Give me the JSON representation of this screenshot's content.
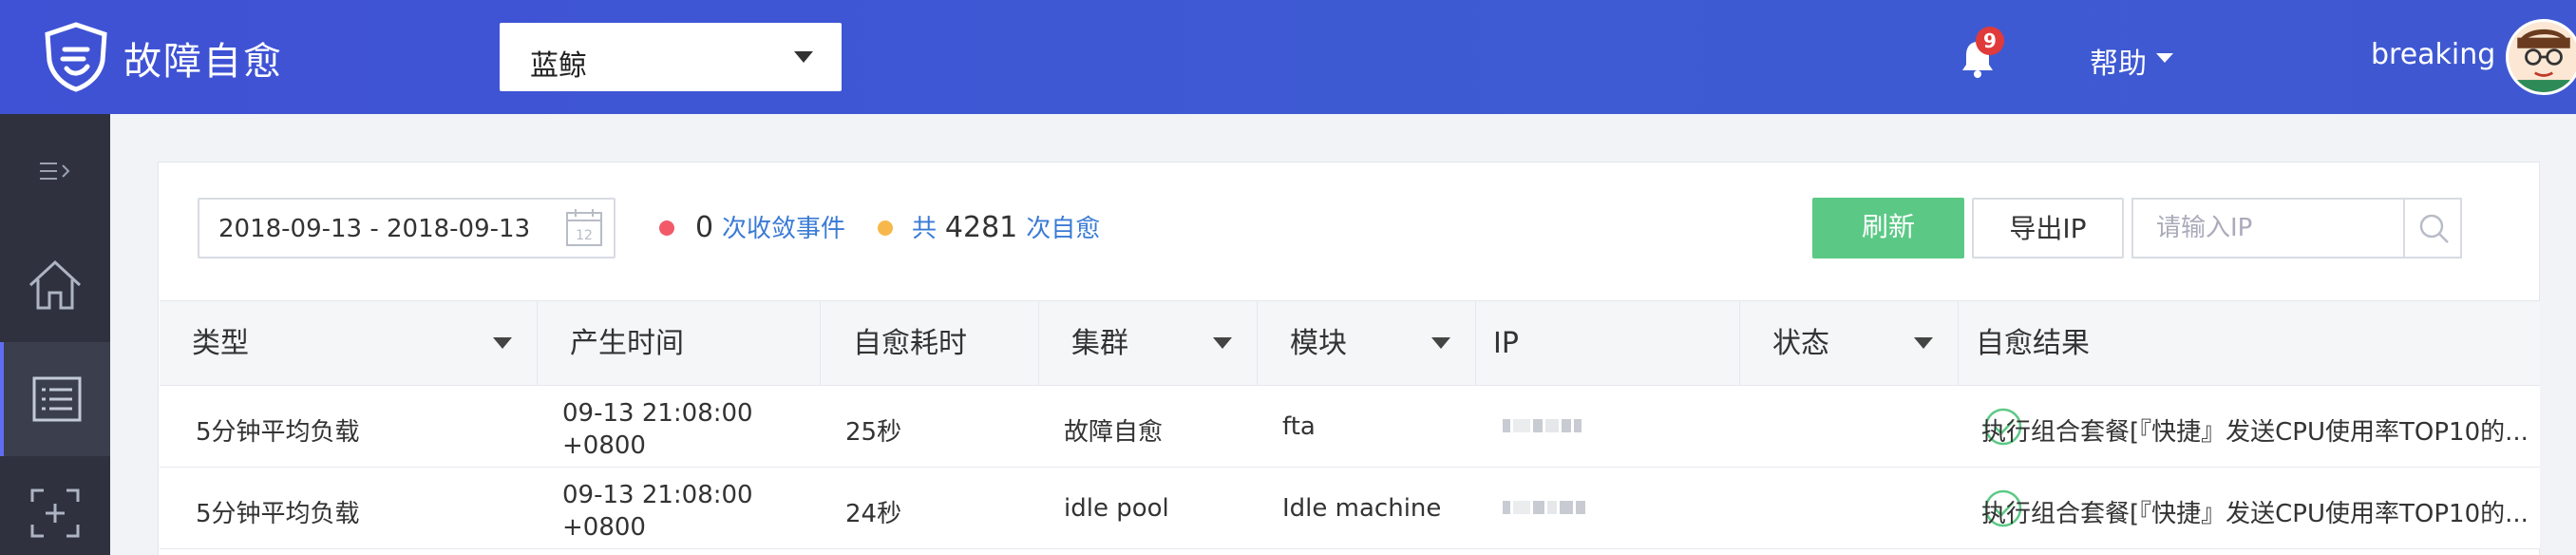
{
  "header": {
    "brand": "故障自愈",
    "cluster_select": "蓝鲸",
    "notification_count": "9",
    "help": "帮助",
    "username": "breaking"
  },
  "sidebar": {
    "items": [
      "menu-toggle",
      "home",
      "list",
      "add-scope"
    ]
  },
  "toolbar": {
    "date_range": "2018-09-13 - 2018-09-13",
    "converge_count": "0",
    "converge_label": "次收敛事件",
    "total_prefix": "共",
    "total_count": "4281",
    "total_label": "次自愈",
    "refresh": "刷新",
    "export_ip": "导出IP",
    "ip_placeholder": "请输入IP"
  },
  "table": {
    "headers": [
      "类型",
      "产生时间",
      "自愈耗时",
      "集群",
      "模块",
      "IP",
      "状态",
      "自愈结果"
    ],
    "rows": [
      {
        "type": "5分钟平均负载",
        "time_line1": "09-13 21:08:00",
        "time_line2": "+0800",
        "duration": "25秒",
        "cluster": "故障自愈",
        "module": "fta",
        "status": "success",
        "result": "执行组合套餐[『快捷』发送CPU使用率TOP10的..."
      },
      {
        "type": "5分钟平均负载",
        "time_line1": "09-13 21:08:00",
        "time_line2": "+0800",
        "duration": "24秒",
        "cluster": "idle pool",
        "module": "Idle machine",
        "status": "success",
        "result": "执行组合套餐[『快捷』发送CPU使用率TOP10的..."
      }
    ]
  },
  "colors": {
    "header_bg": "#3f51d4",
    "sidebar_bg": "#2f323e",
    "refresh_btn": "#5bc985",
    "link": "#3a7bd5",
    "success": "#5bc985",
    "badge": "#e03a3a"
  }
}
